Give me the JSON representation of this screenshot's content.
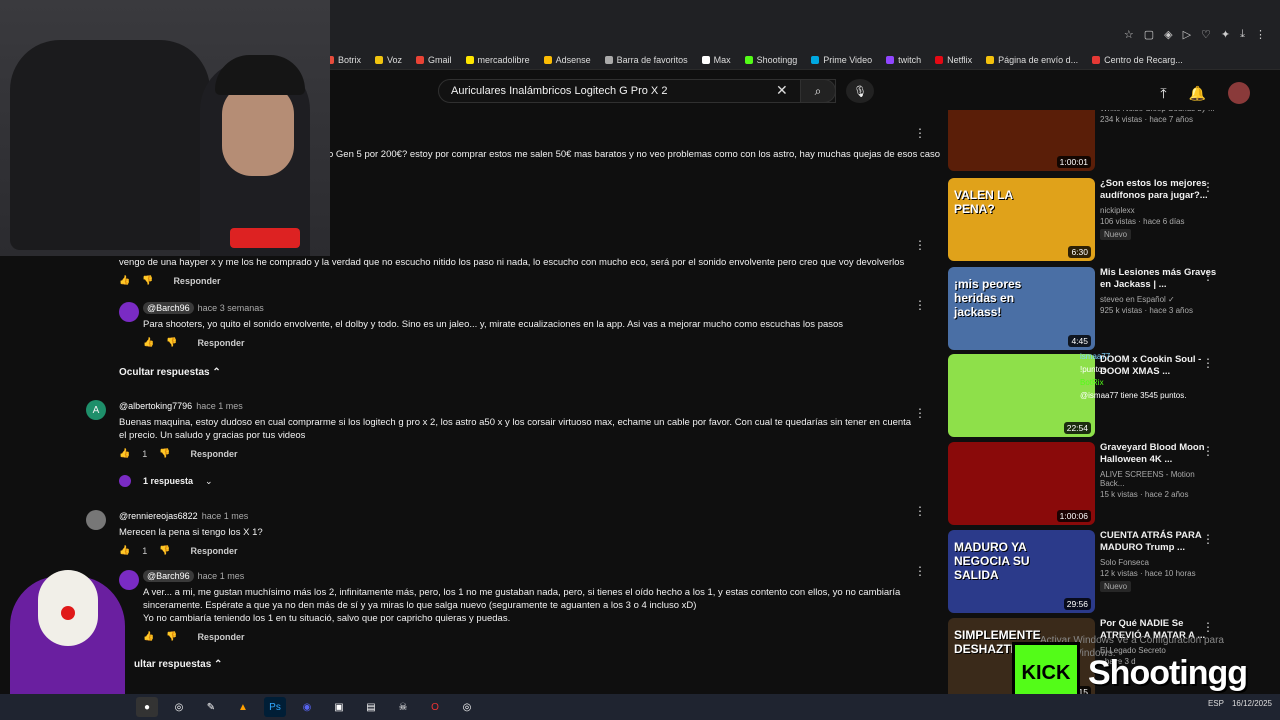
{
  "browser": {
    "bookmarks": [
      {
        "label": "Botrix",
        "color": "#e74c3c"
      },
      {
        "label": "Voz",
        "color": "#f1c40f"
      },
      {
        "label": "Gmail",
        "color": "#ea4335"
      },
      {
        "label": "mercadolibre",
        "color": "#ffe600"
      },
      {
        "label": "Adsense",
        "color": "#fbbc04"
      },
      {
        "label": "Barra de favoritos",
        "color": "#aaaaaa"
      },
      {
        "label": "Max",
        "color": "#ffffff"
      },
      {
        "label": "Shootingg",
        "color": "#53fc18"
      },
      {
        "label": "Prime Video",
        "color": "#00a8e1"
      },
      {
        "label": "twitch",
        "color": "#9146ff"
      },
      {
        "label": "Netflix",
        "color": "#e50914"
      },
      {
        "label": "Página de envío d...",
        "color": "#f4c20d"
      },
      {
        "label": "Centro de Recarg...",
        "color": "#e53935"
      }
    ]
  },
  "youtube": {
    "search_value": "Auriculares Inalámbricos Logitech G Pro X 2"
  },
  "comments": {
    "top_partial": "o Gen 5 por 200€? estoy por comprar estos me salen 50€ mas baratos y no veo problemas como con los astro, hay muchas quejas de esos casos",
    "c1_text": "vengo de una hayper x y me los he comprado y la verdad que no escucho nitido los paso ni nada, lo escucho con mucho eco, será por el sonido envolvente pero creo que voy  devolverlos",
    "reply_label": "Responder",
    "r1_handle": "@Barch96",
    "r1_time": "hace 3 semanas",
    "r1_text": "Para shooters, yo quito el sonido envolvente, el dolby y todo. Sino es un jaleo... y, mirate ecualizaciones en la app. Asi vas a mejorar mucho como escuchas los pasos",
    "hide_replies": "Ocultar respuestas",
    "c2_avatar_letter": "A",
    "c2_handle": "@albertoking7796",
    "c2_time": "hace 1 mes",
    "c2_text": "Buenas maquina, estoy dudoso en cual comprarme si los logitech g pro x 2, los astro a50 x y los corsair virtuoso max, echame un cable por favor. Con cual te quedarías sin tener en cuenta el precio. Un saludo y gracias por tus videos",
    "c2_likes": "1",
    "c2_replies": "1 respuesta",
    "c3_handle": "@renniereojas6822",
    "c3_time": "hace 1 mes",
    "c3_text": "Merecen la pena si tengo los X 1?",
    "c3_likes": "1",
    "r2_handle": "@Barch96",
    "r2_time": "hace 1 mes",
    "r2_text1": "A ver... a mi, me gustan muchísimo más los 2, infinitamente más, pero, los 1 no me gustaban nada, pero, si tienes el oído hecho a los 1, y estas contento con ellos, yo no cambiaría sinceramente. Espérate a que ya no den más de sí y ya miras lo que salga nuevo (seguramente te aguanten a los 3 o 4 incluso xD)",
    "r2_text2": "Yo no cambiaría teniendo los 1 en tu situació, salvo que por capricho quieras y puedas.",
    "hide_replies_2": "ultar respuestas"
  },
  "sidebar": {
    "videos": [
      {
        "title": "elephant - Tonal ...",
        "channel": "White Noise Sleep Sounds by ...",
        "meta": "234 k vistas · hace 7 años",
        "duration": "1:00:01",
        "badge": "",
        "bg": "#5a1e08"
      },
      {
        "title": "¿Son estos los mejores audífonos para jugar?...",
        "channel": "nickiplexx",
        "meta": "106 vistas · hace 6 días",
        "duration": "6:30",
        "badge": "Nuevo",
        "bg": "#e0a21a",
        "thumb_text": "VALEN LA PENA?"
      },
      {
        "title": "Mis Lesiones más Graves en Jackass | ...",
        "channel": "steveo en Español ✓",
        "meta": "925 k vistas · hace 3 años",
        "duration": "4:45",
        "badge": "",
        "bg": "#4a6fa5",
        "thumb_text": "¡mis peores heridas en jackass!"
      },
      {
        "title": "DOOM x Cookin Soul - DOOM XMAS ...",
        "channel": "",
        "meta": "",
        "duration": "22:54",
        "badge": "",
        "bg": "#8ee04a"
      },
      {
        "title": "Graveyard Blood Moon Halloween 4K ...",
        "channel": "ALIVE SCREENS - Motion Back...",
        "meta": "15 k vistas · hace 2 años",
        "duration": "1:00:06",
        "badge": "",
        "bg": "#8a0a0a"
      },
      {
        "title": "CUENTA ATRÁS PARA MADURO Trump ...",
        "channel": "Solo Fonseca",
        "meta": "12 k vistas · hace 10 horas",
        "duration": "29:56",
        "badge": "Nuevo",
        "bg": "#2b3a8a",
        "thumb_text": "MADURO YA NEGOCIA SU SALIDA"
      },
      {
        "title": "Por Qué NADIE Se ATREVIÓ A MATAR A ...",
        "channel": "El Legado Secreto",
        "meta": "· hace 3 d",
        "duration": "15",
        "badge": "",
        "bg": "#3a2a1a",
        "thumb_text": "SIMPLEMENTE DESHAZTE"
      }
    ]
  },
  "chat": {
    "user1": "ismaa77",
    "msg1": "!puntos",
    "bot": "BotRix",
    "msg2": "@ismaa77 tiene 3545 puntos."
  },
  "overlay": {
    "kick": "KICK",
    "brand": "Shootingg",
    "activate": "Activar Windows Ve a Configuración para activar Windows."
  },
  "taskbar": {
    "lang": "ESP",
    "date": "16/12/2025"
  }
}
